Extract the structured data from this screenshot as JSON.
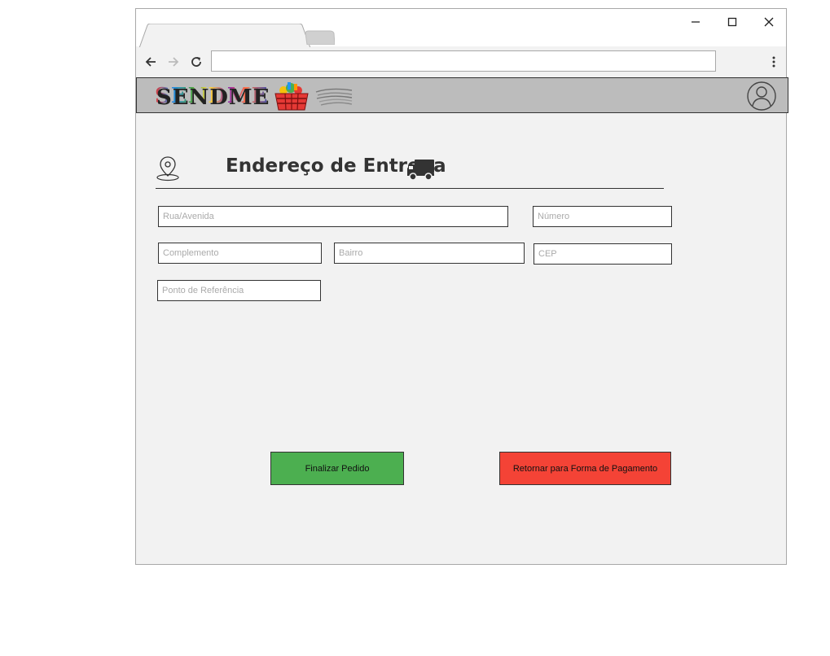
{
  "browser": {
    "address_value": "",
    "tab_title": ""
  },
  "app": {
    "logo_text": "SENDME"
  },
  "section": {
    "title": "Endereço de Entrega"
  },
  "form": {
    "street_placeholder": "Rua/Avenida",
    "number_placeholder": "Número",
    "complement_placeholder": "Complemento",
    "neighborhood_placeholder": "Bairro",
    "zip_placeholder": "CEP",
    "reference_placeholder": "Ponto de Referência"
  },
  "actions": {
    "finish_label": "Finalizar Pedido",
    "back_label": "Retornar para Forma de Pagamento"
  },
  "colors": {
    "finish_bg": "#4caf50",
    "back_bg": "#f44336",
    "appbar_bg": "#bcbcbc"
  },
  "icons": {
    "location": "location-pin-icon",
    "truck": "truck-icon",
    "user": "user-avatar-icon"
  }
}
